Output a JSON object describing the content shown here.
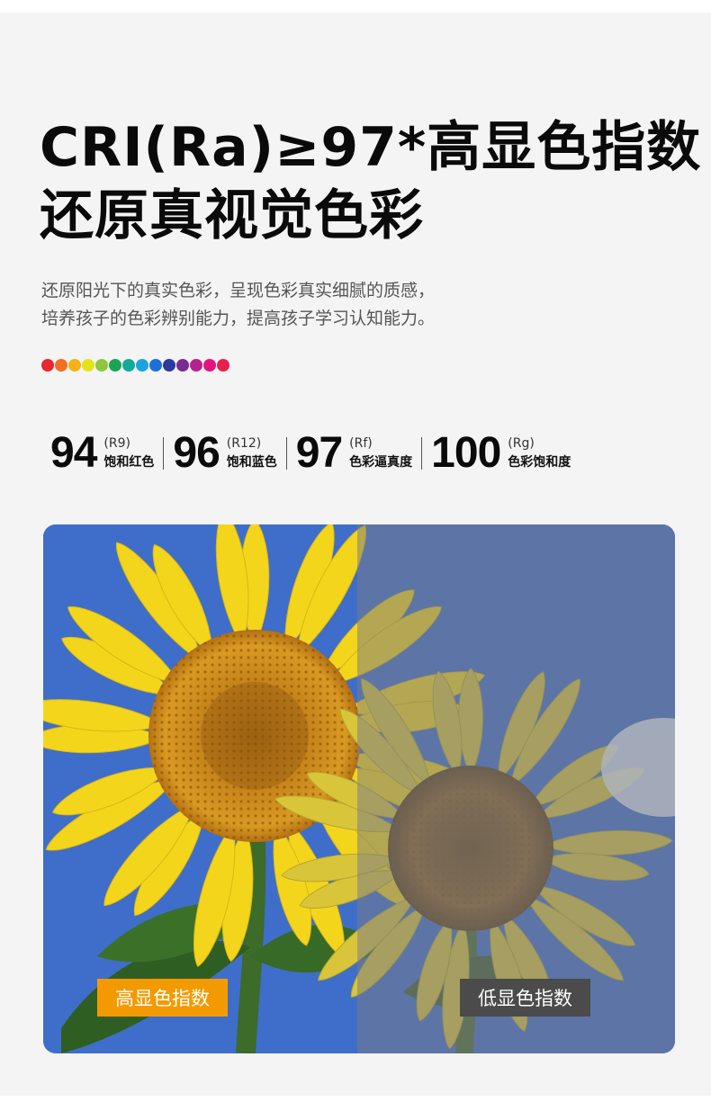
{
  "headline": {
    "line1": "CRI(Ra)≥97*高显色指数",
    "line2": "还原真视觉色彩"
  },
  "description": {
    "line1": "还原阳光下的真实色彩，呈现色彩真实细腻的质感，",
    "line2": "培养孩子的色彩辨别能力，提高孩子学习认知能力。"
  },
  "color_dots": [
    "#e8262b",
    "#f36e1f",
    "#f6b216",
    "#e4e318",
    "#8dc63f",
    "#1aa556",
    "#14a99b",
    "#1ba3e0",
    "#1d6fd8",
    "#2c3a9f",
    "#7b2a8f",
    "#b8208f",
    "#e5127d",
    "#ea1f4c"
  ],
  "stats": [
    {
      "value": "94",
      "code": "(R9)",
      "label": "饱和红色"
    },
    {
      "value": "96",
      "code": "(R12)",
      "label": "饱和蓝色"
    },
    {
      "value": "97",
      "code": "(Rf)",
      "label": "色彩逼真度"
    },
    {
      "value": "100",
      "code": "(Rg)",
      "label": "色彩饱和度"
    }
  ],
  "comparison": {
    "high_label": "高显色指数",
    "low_label": "低显色指数"
  },
  "colors": {
    "background": "#f4f4f4",
    "high_badge": "#f39a00",
    "low_badge": "#4b4b4b",
    "sky_high": "#3e6ec9",
    "sky_low": "#5b6f94"
  }
}
